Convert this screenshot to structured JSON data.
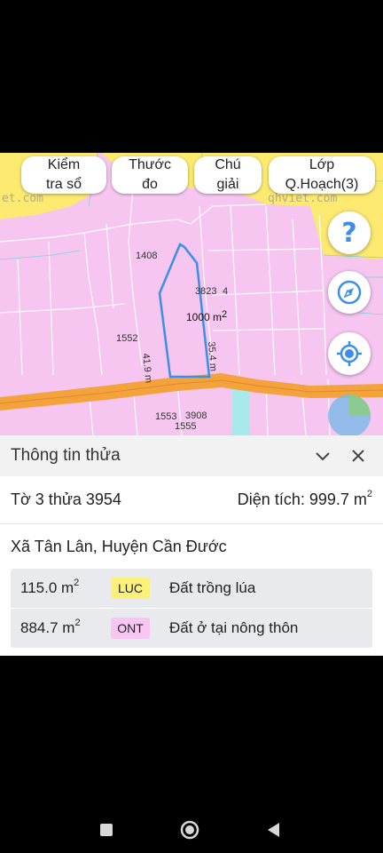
{
  "toolbar": {
    "check_button": "Kiểm\ntra sổ",
    "ruler_button": "Thước\nđo",
    "legend_button": "Chú\ngiải",
    "layer_button": "Lớp\nQ.Hoạch(3)"
  },
  "map": {
    "watermark_left": "et.com",
    "watermark_right": "qhviet.com",
    "parcel_labels": {
      "p1408": "1408",
      "p3823": "3823",
      "p_4": "4",
      "p1552": "1552",
      "p1553": "1553",
      "p3908": "3908",
      "p1555": "1555"
    },
    "area_label": "1000 m",
    "area_sup": "2",
    "edge_left": "41.9 m",
    "edge_right": "35.4 m",
    "colors": {
      "residential": "#f6c6f1",
      "agri": "#fbe970",
      "road": "#f3a23c",
      "canal": "#a8e9ee",
      "selection": "#3a8fe6"
    }
  },
  "fabs": {
    "help_icon": "question-icon",
    "compass_icon": "compass-icon",
    "locate_icon": "locate-icon"
  },
  "sheet": {
    "title": "Thông tin thửa",
    "parcel_id": "Tờ 3 thửa 3954",
    "area_label": "Diện tích: 999.7 m",
    "area_sup": "2",
    "location": "Xã Tân Lân, Huyện Cần Đước",
    "uses": [
      {
        "area": "115.0 m",
        "sup": "2",
        "code": "LUC",
        "desc": "Đất trồng lúa",
        "color": "#fbf07a"
      },
      {
        "area": "884.7 m",
        "sup": "2",
        "code": "ONT",
        "desc": "Đất ở tại nông thôn",
        "color": "#f7c6f2"
      }
    ]
  }
}
